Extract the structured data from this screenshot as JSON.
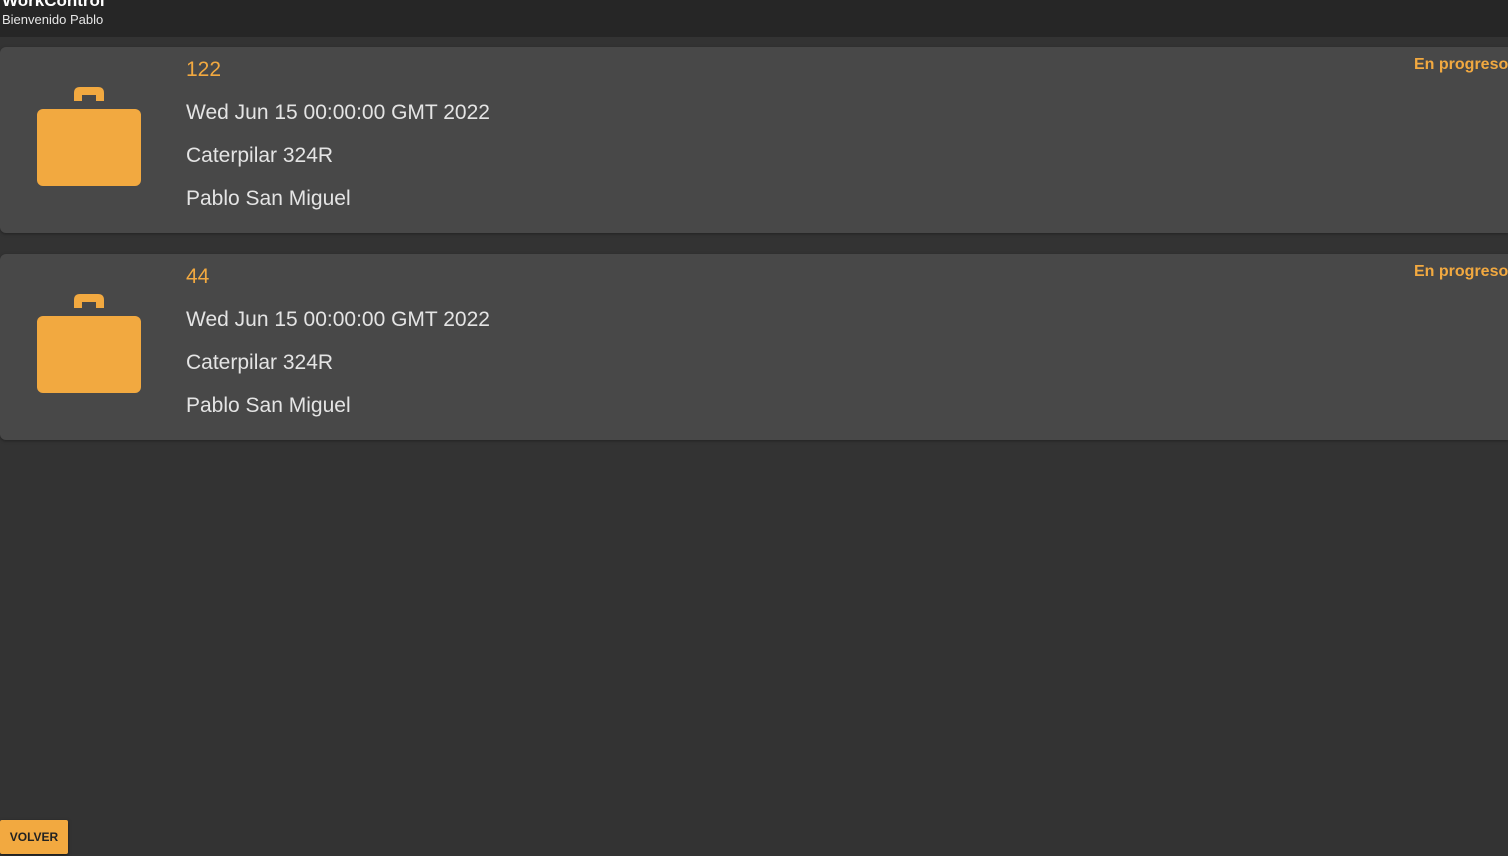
{
  "app": {
    "title": "WorkControl",
    "subtitle": "Bienvenido Pablo"
  },
  "theme": {
    "background": "#333333",
    "toolbar": "#262626",
    "card": "#484848",
    "accent": "#f2a940",
    "text": "#e4e4e4"
  },
  "orders": [
    {
      "id": "122",
      "date": "Wed Jun 15 00:00:00 GMT 2022",
      "machine": "Caterpilar 324R",
      "person": "Pablo San Miguel",
      "status": "En progreso",
      "icon": "briefcase-icon"
    },
    {
      "id": "44",
      "date": "Wed Jun 15 00:00:00 GMT 2022",
      "machine": "Caterpilar 324R",
      "person": "Pablo San Miguel",
      "status": "En progreso",
      "icon": "briefcase-icon"
    }
  ],
  "footer": {
    "back_label": "VOLVER"
  }
}
